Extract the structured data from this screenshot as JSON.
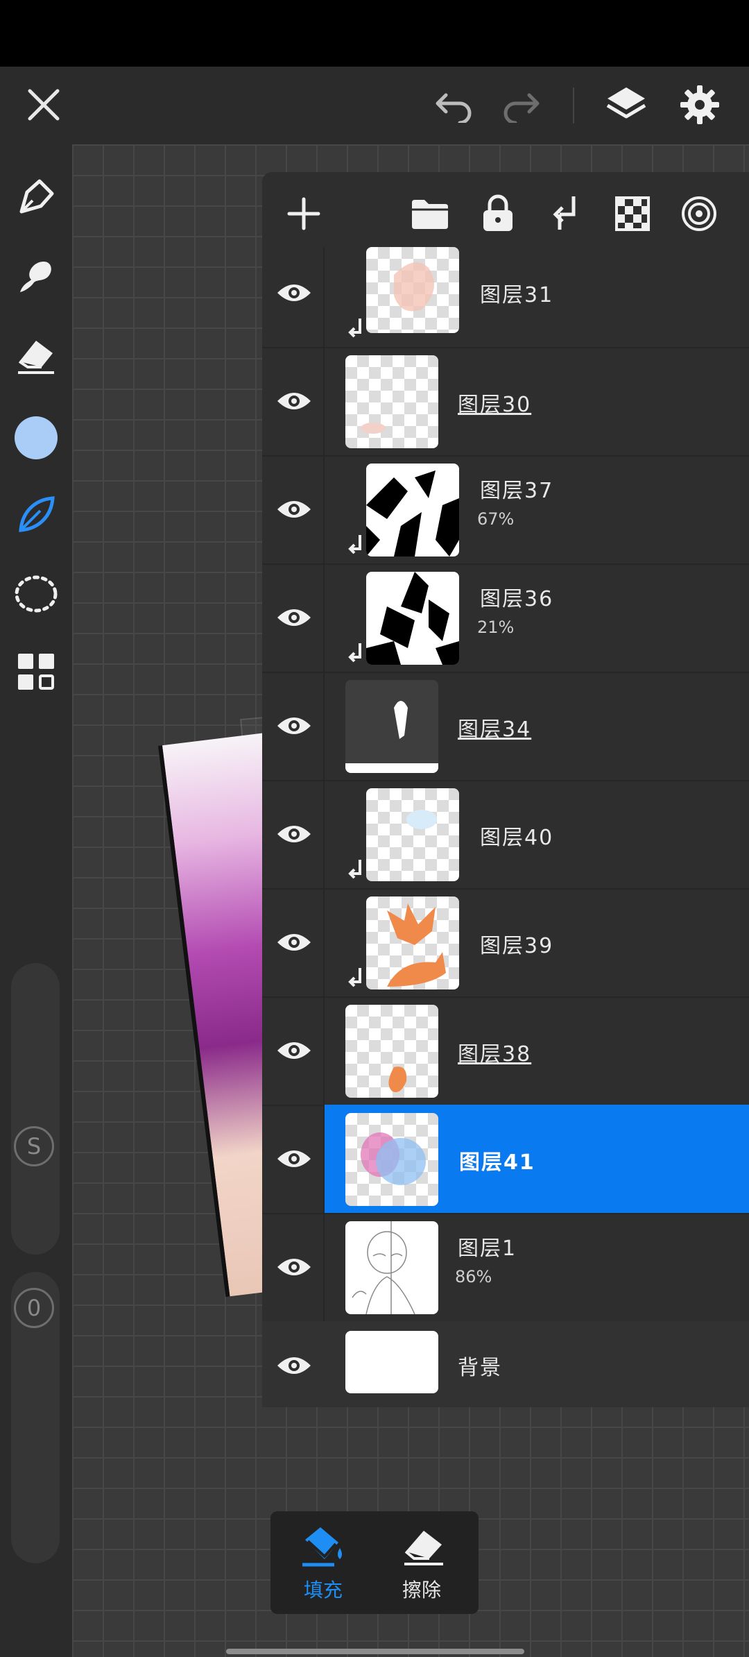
{
  "app": {
    "colors": {
      "accent": "#0a7af0",
      "brush_color": "#a9cdf7",
      "panel_bg": "#2e2e2e"
    }
  },
  "topbar": {
    "close_icon": "close-icon",
    "undo_icon": "undo-icon",
    "redo_icon": "redo-icon",
    "layers_icon": "layers-icon",
    "settings_icon": "settings-icon"
  },
  "sidebar": {
    "tools": [
      "pen-tool-icon",
      "smudge-tool-icon",
      "eraser-tool-icon",
      "color-swatch",
      "leaf-brush-icon",
      "lasso-select-icon",
      "grid-menu-icon"
    ],
    "size_badge": "S",
    "opacity_badge": "0"
  },
  "layer_panel": {
    "toolbar_icons": [
      "add-layer-icon",
      "folder-icon",
      "lock-icon",
      "clip-mask-icon",
      "transparency-icon",
      "target-icon"
    ],
    "layers": [
      {
        "name": "图层31",
        "opacity": "",
        "clipped": true,
        "underline": false,
        "selected": false
      },
      {
        "name": "图层30",
        "opacity": "",
        "clipped": false,
        "underline": true,
        "selected": false
      },
      {
        "name": "图层37",
        "opacity": "67%",
        "clipped": true,
        "underline": false,
        "selected": false
      },
      {
        "name": "图层36",
        "opacity": "21%",
        "clipped": true,
        "underline": false,
        "selected": false
      },
      {
        "name": "图层34",
        "opacity": "",
        "clipped": false,
        "underline": true,
        "selected": false
      },
      {
        "name": "图层40",
        "opacity": "",
        "clipped": true,
        "underline": false,
        "selected": false
      },
      {
        "name": "图层39",
        "opacity": "",
        "clipped": true,
        "underline": false,
        "selected": false
      },
      {
        "name": "图层38",
        "opacity": "",
        "clipped": false,
        "underline": true,
        "selected": false
      },
      {
        "name": "图层41",
        "opacity": "",
        "clipped": false,
        "underline": false,
        "selected": true
      },
      {
        "name": "图层1",
        "opacity": "86%",
        "clipped": false,
        "underline": false,
        "selected": false
      },
      {
        "name": "背景",
        "opacity": "",
        "clipped": false,
        "underline": false,
        "selected": false
      }
    ]
  },
  "bottombar": {
    "fill_label": "填充",
    "erase_label": "擦除"
  }
}
